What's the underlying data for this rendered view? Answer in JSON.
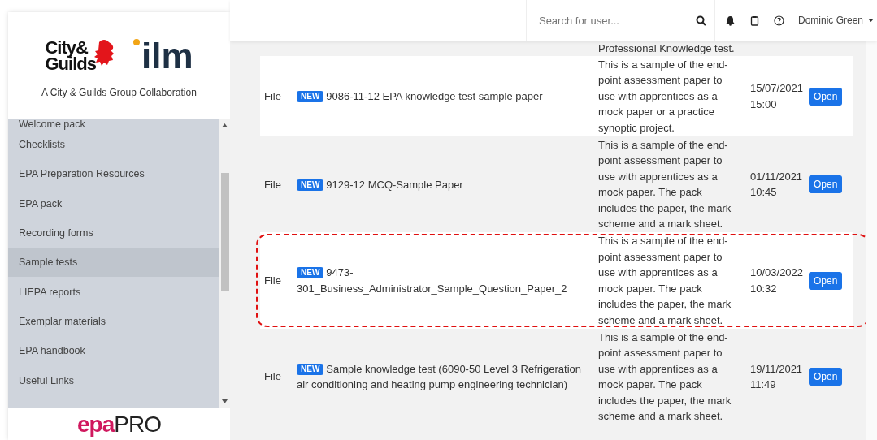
{
  "sidebar": {
    "logo": {
      "line1": "City&",
      "line2": "Guilds",
      "brand2": "ilm",
      "tagline": "A City & Guilds Group Collaboration"
    },
    "items": [
      {
        "label": "Welcome pack",
        "selected": false
      },
      {
        "label": "Checklists",
        "selected": false
      },
      {
        "label": "EPA Preparation Resources",
        "selected": false
      },
      {
        "label": "EPA pack",
        "selected": false
      },
      {
        "label": "Recording forms",
        "selected": false
      },
      {
        "label": "Sample tests",
        "selected": true
      },
      {
        "label": "LIEPA reports",
        "selected": false
      },
      {
        "label": "Exemplar materials",
        "selected": false
      },
      {
        "label": "EPA handbook",
        "selected": false
      },
      {
        "label": "Useful Links",
        "selected": false
      }
    ],
    "footer_logo": {
      "part1": "epa",
      "part2": "PRO"
    }
  },
  "topbar": {
    "search": {
      "placeholder": "Search for user..."
    },
    "user": "Dominic Green"
  },
  "table": {
    "rows": [
      {
        "description": "Professional Knowledge test.",
        "highlighted": false
      },
      {
        "type": "File",
        "badge": "NEW",
        "title": "9086-11-12 EPA knowledge test sample paper",
        "description": "This is a sample of the end-point assessment paper to use with apprentices as a mock paper or a practice synoptic project.",
        "date": "15/07/2021 15:00",
        "action": "Open",
        "highlighted": false
      },
      {
        "type": "File",
        "badge": "NEW",
        "title": "9129-12 MCQ-Sample Paper",
        "description": "This is a sample of the end-point assessment paper to use with apprentices as a mock paper. The pack includes the paper, the mark scheme and a mark sheet.",
        "date": "01/11/2021 10:45",
        "action": "Open",
        "highlighted": false
      },
      {
        "type": "File",
        "badge": "NEW",
        "title": "9473-301_Business_Administrator_Sample_Question_Paper_2",
        "description": "This is a sample of the end-point assessment paper to use with apprentices as a mock paper. The pack includes the paper, the mark scheme and a mark sheet.",
        "date": "10/03/2022 10:32",
        "action": "Open",
        "highlighted": true
      },
      {
        "type": "File",
        "badge": "NEW",
        "title": "Sample knowledge test (6090-50 Level 3 Refrigeration air conditioning and heating pump engineering technician)",
        "description": "This is a sample of the end-point assessment paper to use with apprentices as a mock paper. The pack includes the paper, the mark scheme and a mark sheet.",
        "date": "19/11/2021 11:49",
        "action": "Open",
        "highlighted": false
      }
    ]
  }
}
